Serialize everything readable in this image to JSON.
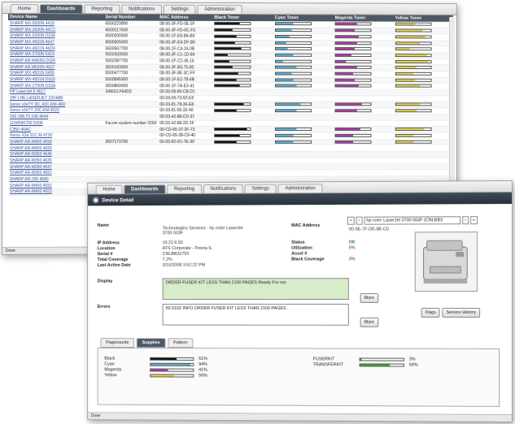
{
  "back_window": {
    "tabs": [
      "Home",
      "Dashboards",
      "Reporting",
      "Notifications",
      "Settings",
      "Administration"
    ],
    "active_tab": "Dashboards",
    "columns": [
      "Device Name",
      "Serial Number",
      "MAC Address",
      "Black Toner",
      "Cyan Toner",
      "Magenta Toner",
      "Yellow Toner"
    ],
    "rows": [
      {
        "name": "SHARP MX-5000N 4418",
        "serial": "6500223890",
        "mac": "08-00-3F-FD-0E-2F",
        "t": [
          0.7,
          0.5,
          0.6,
          0.55
        ]
      },
      {
        "name": "SHARP MX-3500N 46CC",
        "serial": "6500217600",
        "mac": "08-00-3F-FD-0C-F3",
        "t": [
          0.5,
          0.45,
          0.55,
          0.75
        ]
      },
      {
        "name": "SHARP MX-6200N D334",
        "serial": "6500200500",
        "mac": "08-00-1F-E8-8A-B0",
        "t": [
          0.6,
          0.4,
          0.65,
          0.85
        ]
      },
      {
        "name": "SHARP MX-4501N 4647",
        "serial": "6500509300",
        "mac": "08-00-3F-E4-DF-B6",
        "t": [
          0.55,
          0.3,
          0.6,
          0.7
        ]
      },
      {
        "name": "SHARP MX-4501N 46D9",
        "serial": "5500567700",
        "mac": "08-00-1F-C4-24-0B",
        "t": [
          0.75,
          0.35,
          0.55,
          0.4
        ]
      },
      {
        "name": "SHARP MX-2700N 5414",
        "serial": "5502433000",
        "mac": "08-00-3F-C1-1D-84",
        "t": [
          0.35,
          0.5,
          0.45,
          0.9
        ]
      },
      {
        "name": "SHARP AR-M455N D326",
        "serial": "5502387700",
        "mac": "08-00-1F-C2-36-16",
        "t": [
          0.4,
          0.2,
          0.3,
          0.95
        ]
      },
      {
        "name": "SHARP AR-M620N 4637",
        "serial": "3500183900",
        "mac": "08-00-3F-B3-75-8C",
        "t": [
          0.5,
          0.6,
          0.6,
          0.6
        ]
      },
      {
        "name": "SHARP MX-4501N 6406",
        "serial": "5500477700",
        "mac": "08-00-3F-8E-3C-FF",
        "t": [
          0.65,
          0.45,
          0.5,
          0.5
        ]
      },
      {
        "name": "SHARP MX-4501N D333",
        "serial": "5500845900",
        "mac": "08-00-1F-E2-78-6B",
        "t": [
          0.6,
          0.5,
          0.55,
          0.55
        ]
      },
      {
        "name": "SHARP MX-2700N D33A",
        "serial": "3500869900",
        "mac": "08-00-1F-7A-E3-41",
        "t": [
          0.7,
          0.6,
          0.65,
          0.7
        ]
      },
      {
        "name": "HP LaserJet 5 4617",
        "serial": "S4601LF64D3",
        "mac": "00-03-09-89-CB-D1",
        "t": []
      },
      {
        "name": "(HP LHE LASERJET 3314AB",
        "serial": "",
        "mac": "00-03-09-73-92-E8",
        "t": []
      },
      {
        "name": "Xerox x3eTY 3D_43C-KM-46D",
        "serial": "",
        "mac": "00-03-81-78-36-E8",
        "t": [
          0.8,
          0.7,
          0.75,
          0.7
        ]
      },
      {
        "name": "Xerox x3eTY 20C-KM 4623",
        "serial": "",
        "mac": "00-03-81-55-33-40",
        "t": [
          0.6,
          0.6,
          0.6,
          0.6
        ]
      },
      {
        "name": "192.168.70.168 4644",
        "serial": "",
        "mac": "00-03-42-88-CD-37",
        "t": []
      },
      {
        "name": "1158586700 D308",
        "serial": "Facom system number 0200",
        "mac": "00-03-42-88-2D-2F",
        "t": []
      },
      {
        "name": "C350 46AC",
        "serial": "",
        "mac": "00-CD-65-37-2F-73",
        "t": [
          0.9,
          0.6,
          0.7,
          0.8
        ]
      },
      {
        "name": "Xerox X3e 31C-M 4730",
        "serial": "",
        "mac": "00-CD-65-38-C9-40",
        "t": [
          0.7,
          0.5,
          0.5,
          0.5
        ]
      },
      {
        "name": "SHARP AR-M450 4658",
        "serial": "3507173700",
        "mac": "00-03-82-0C-7E-30",
        "t": [
          0.6,
          0.5,
          0.5,
          0.5
        ]
      },
      {
        "name": "SHARP AR-M450 4659",
        "serial": "",
        "mac": "",
        "t": []
      },
      {
        "name": "SHARP AR-M350 4646",
        "serial": "",
        "mac": "",
        "t": []
      },
      {
        "name": "SHARP AR-M350 4626",
        "serial": "",
        "mac": "",
        "t": []
      },
      {
        "name": "SHARP AR-M280 4647",
        "serial": "",
        "mac": "",
        "t": []
      },
      {
        "name": "SHARP AR-M350 4651",
        "serial": "",
        "mac": "",
        "t": []
      },
      {
        "name": "SHARP AR-235 4640",
        "serial": "",
        "mac": "",
        "t": []
      },
      {
        "name": "SHARP AR-M450 4652",
        "serial": "",
        "mac": "",
        "t": []
      },
      {
        "name": "SHARP AR-M450 4653",
        "serial": "",
        "mac": "",
        "t": []
      }
    ],
    "status": "Done"
  },
  "front_window": {
    "tabs": [
      "Home",
      "Dashboards",
      "Reporting",
      "Notifications",
      "Settings",
      "Administration"
    ],
    "active_tab": "Dashboards",
    "title": "Device Detail",
    "name_label": "Name",
    "name_value": "Technologies Services - hp color LaserJet 3700 003F",
    "ip_label": "IP Address",
    "ip_value": "10.22.6.93",
    "location_label": "Location",
    "location_value": "ATS Corporate - Peoria IL",
    "serial_label": "Serial #",
    "serial_value": "CNLBB32793",
    "coverage_label": "Total Coverage",
    "coverage_value": "7.2%",
    "active_label": "Last Active Date",
    "active_value": "3/10/2008 3:52:22 PM",
    "mac_label": "MAC Address",
    "mac_value": "00-0E-7F-DE-8B-C0",
    "device_select": "hp color LaserJet 3700 003F (CNLBB3",
    "status_label": "Status",
    "status_value": "OK",
    "util_label": "Utilization",
    "util_value": "5%",
    "asset_label": "Asset #",
    "asset_value": "",
    "black_cov_label": "Black Coverage",
    "black_cov_value": "3%",
    "display_label": "Display",
    "display_value": "ORDER FUSER KIT LESS THAN 2100 PAGES Ready For mo",
    "errors_label": "Errors",
    "errors_value": "59.910Z INFO ORDER FUSER KIT LESS THAN 2100 PAGES.",
    "more_label": "More",
    "flags_label": "Flags",
    "service_label": "Service History",
    "subtabs": [
      "Pagecounts",
      "Supplies",
      "Pattern"
    ],
    "active_subtab": "Supplies",
    "supplies_left": [
      {
        "name": "Black",
        "pct": "61%",
        "level": 0.61,
        "color": "#111111"
      },
      {
        "name": "Cyan",
        "pct": "94%",
        "level": 0.94,
        "color": "#5ab4dc"
      },
      {
        "name": "Magenta",
        "pct": "41%",
        "level": 0.41,
        "color": "#b23aa8"
      },
      {
        "name": "Yellow",
        "pct": "56%",
        "level": 0.56,
        "color": "#e8d84a"
      }
    ],
    "supplies_right": [
      {
        "name": "FUSERKIT",
        "pct": "3%",
        "level": 0.03,
        "color": "#3aa83a"
      },
      {
        "name": "TRANSFERKIT",
        "pct": "69%",
        "level": 0.69,
        "color": "#3aa83a"
      }
    ],
    "status": "Done"
  },
  "colors": {
    "black": "#111111",
    "cyan": "#5ab4dc",
    "magenta": "#b23aa8",
    "yellow": "#e8d84a",
    "header": "#4c5865"
  }
}
